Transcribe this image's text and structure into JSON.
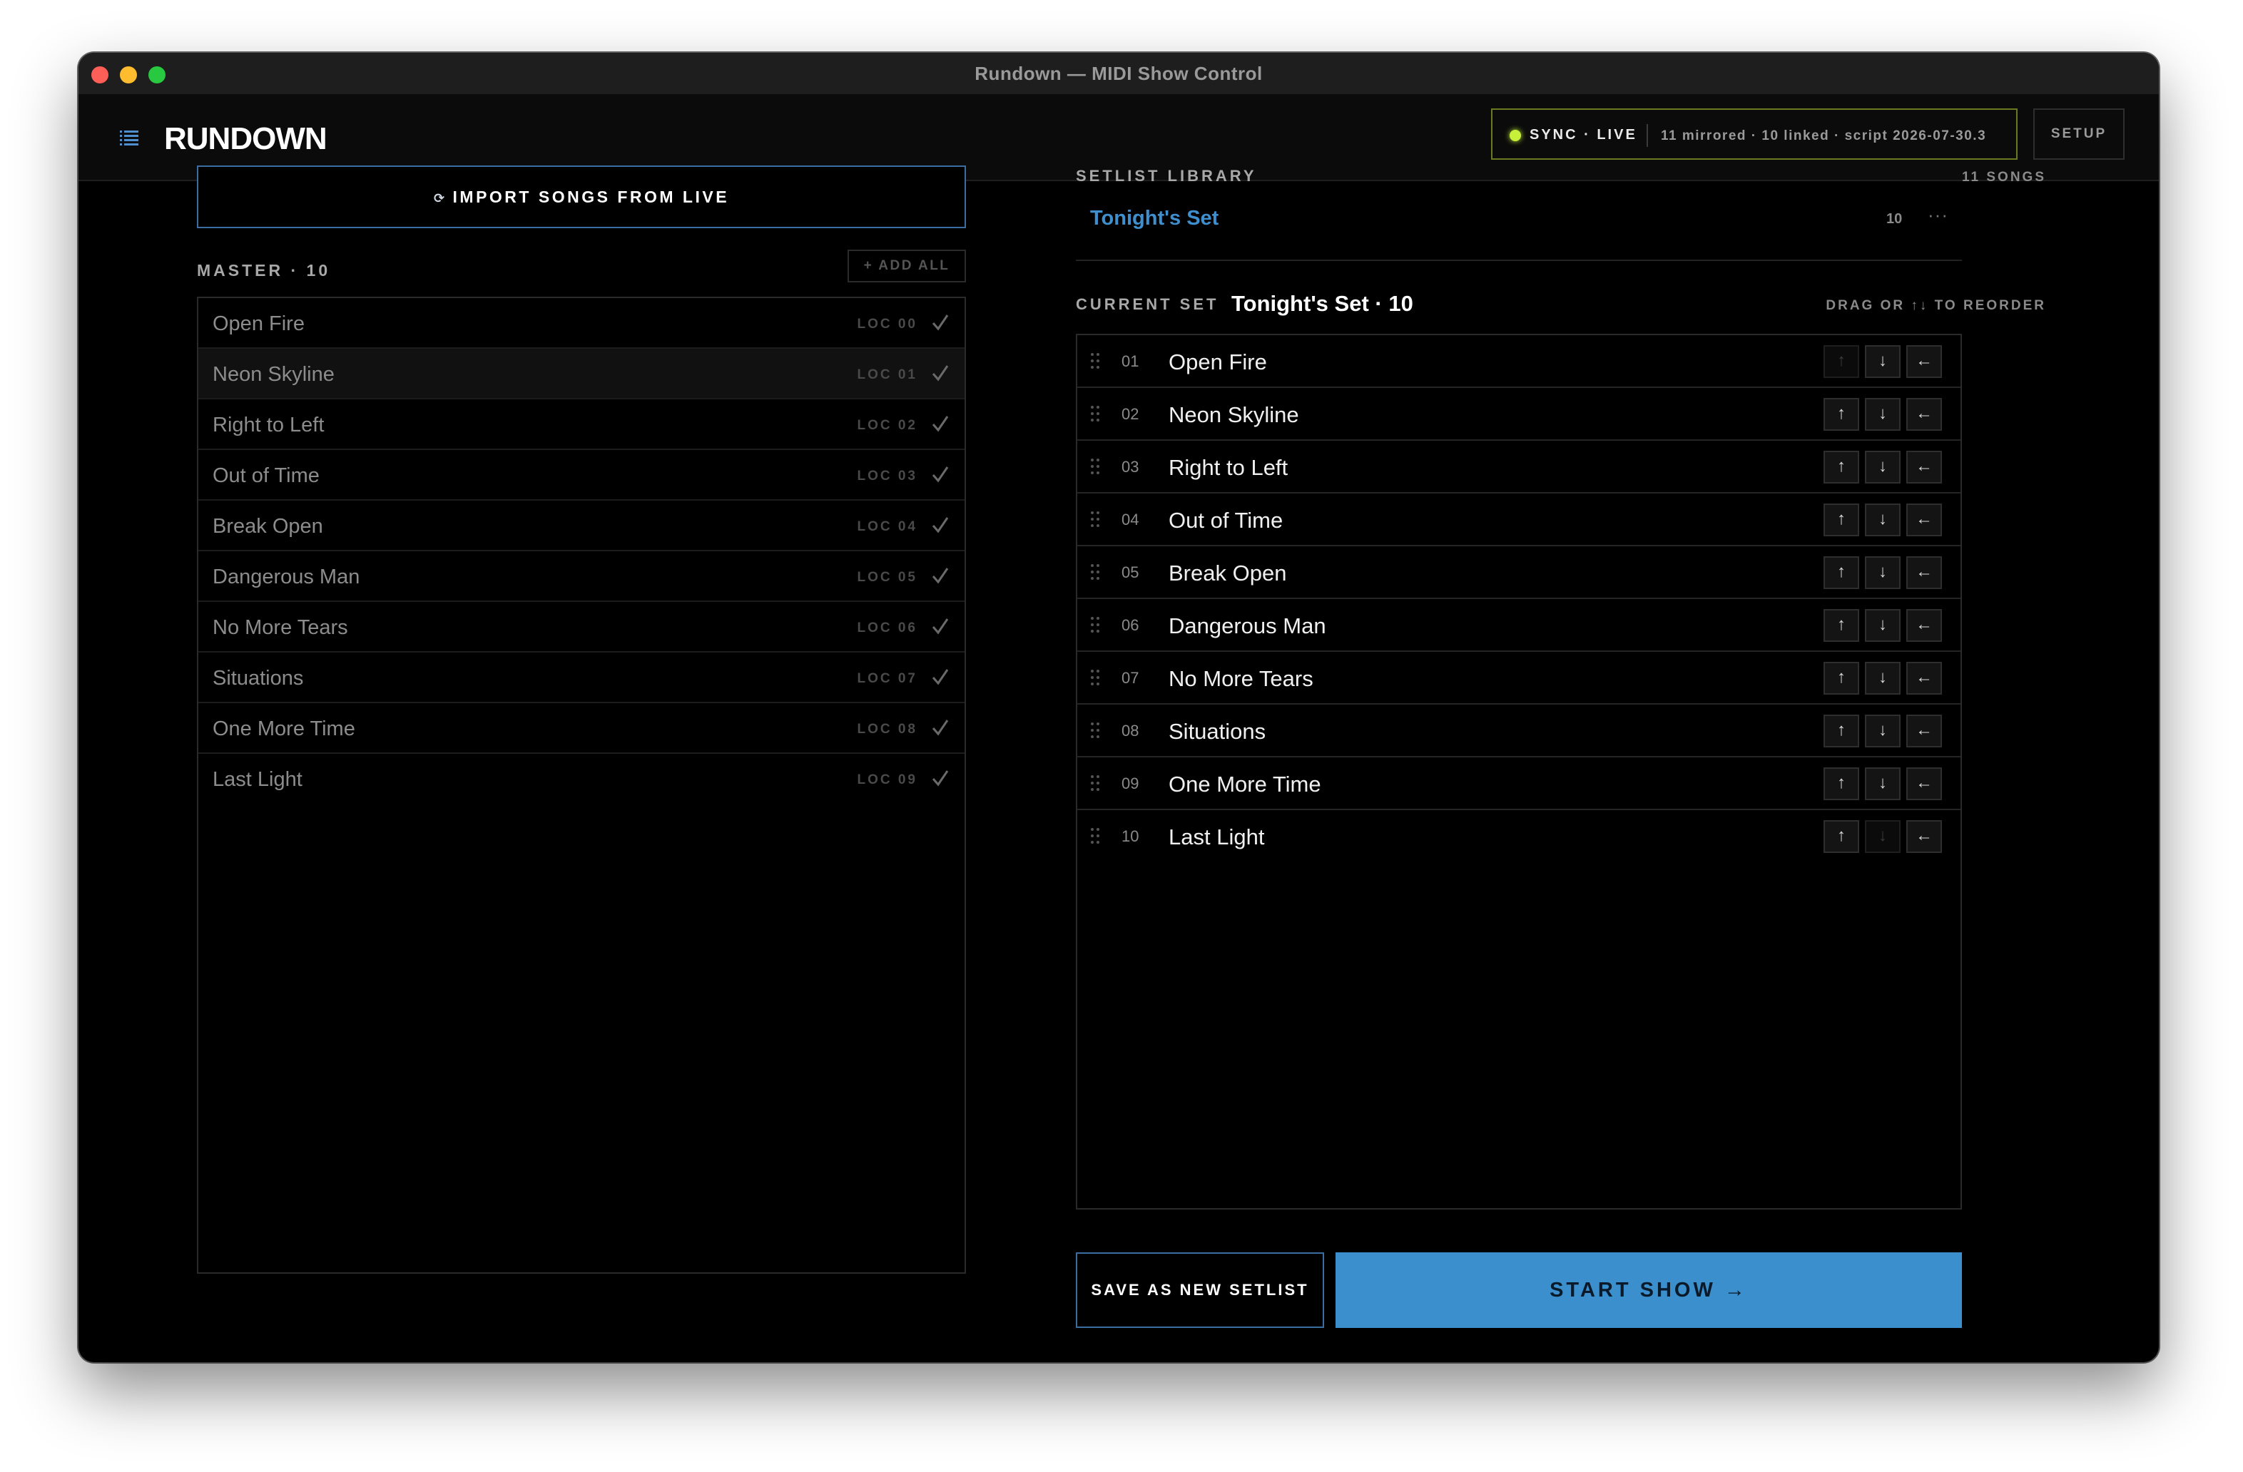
{
  "window": {
    "title": "Rundown — MIDI Show Control"
  },
  "header": {
    "brand": "RUNDOWN",
    "sync_label": "SYNC · LIVE",
    "sync_detail": "11 mirrored · 10 linked · script 2026-07-30.3",
    "setup_label": "SETUP",
    "colors": {
      "sync_dot": "#c6f03a",
      "sync_border": "#6b7a1e"
    }
  },
  "left": {
    "import_label": "IMPORT SONGS FROM LIVE",
    "master_label": "MASTER · 10",
    "add_all_label": "+ ADD ALL",
    "master_songs": [
      {
        "title": "Open Fire",
        "loc": "LOC 00"
      },
      {
        "title": "Neon Skyline",
        "loc": "LOC 01"
      },
      {
        "title": "Right to Left",
        "loc": "LOC 02"
      },
      {
        "title": "Out of Time",
        "loc": "LOC 03"
      },
      {
        "title": "Break Open",
        "loc": "LOC 04"
      },
      {
        "title": "Dangerous Man",
        "loc": "LOC 05"
      },
      {
        "title": "No More Tears",
        "loc": "LOC 06"
      },
      {
        "title": "Situations",
        "loc": "LOC 07"
      },
      {
        "title": "One More Time",
        "loc": "LOC 08"
      },
      {
        "title": "Last Light",
        "loc": "LOC 09"
      }
    ]
  },
  "library": {
    "label": "SETLIST LIBRARY",
    "count": "11 SONGS",
    "items": [
      {
        "name": "Tonight's Set",
        "count": "10",
        "more": "···"
      }
    ],
    "accent": "#3f8fcf"
  },
  "current": {
    "label": "CURRENT SET",
    "name": "Tonight's Set · 10",
    "hint": "DRAG OR ↑↓ TO REORDER",
    "songs": [
      {
        "num": "01",
        "title": "Open Fire"
      },
      {
        "num": "02",
        "title": "Neon Skyline"
      },
      {
        "num": "03",
        "title": "Right to Left"
      },
      {
        "num": "04",
        "title": "Out of Time"
      },
      {
        "num": "05",
        "title": "Break Open"
      },
      {
        "num": "06",
        "title": "Dangerous Man"
      },
      {
        "num": "07",
        "title": "No More Tears"
      },
      {
        "num": "08",
        "title": "Situations"
      },
      {
        "num": "09",
        "title": "One More Time"
      },
      {
        "num": "10",
        "title": "Last Light"
      }
    ],
    "btn_up": "↑",
    "btn_down": "↓",
    "btn_back": "←"
  },
  "footer": {
    "save_label": "SAVE AS NEW SETLIST",
    "start_label": "START SHOW →",
    "start_color": "#3a8fcc"
  }
}
